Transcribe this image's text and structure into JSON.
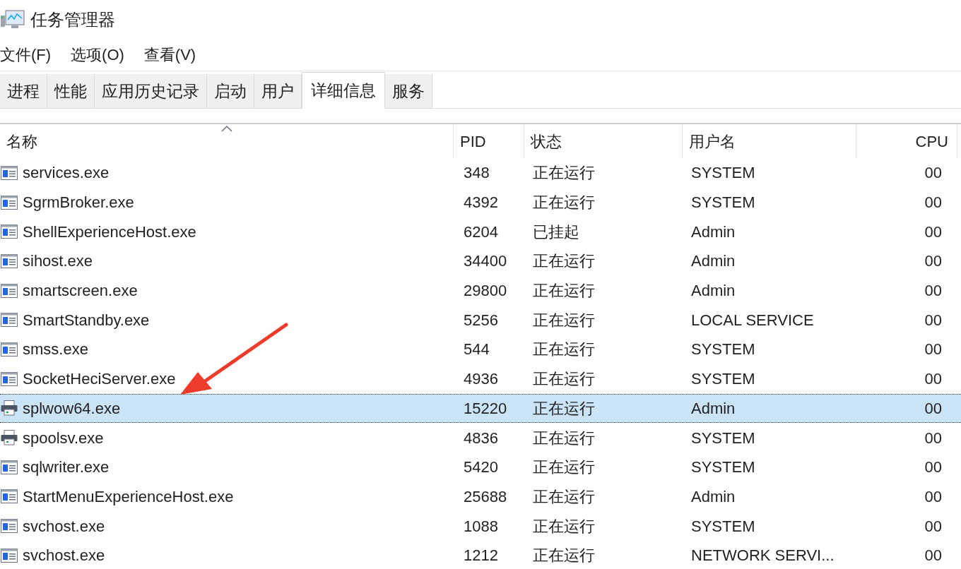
{
  "window": {
    "title": "任务管理器"
  },
  "menu": [
    "文件(F)",
    "选项(O)",
    "查看(V)"
  ],
  "tabs": [
    {
      "label": "进程",
      "selected": false
    },
    {
      "label": "性能",
      "selected": false
    },
    {
      "label": "应用历史记录",
      "selected": false
    },
    {
      "label": "启动",
      "selected": false
    },
    {
      "label": "用户",
      "selected": false
    },
    {
      "label": "详细信息",
      "selected": true
    },
    {
      "label": "服务",
      "selected": false
    }
  ],
  "table": {
    "columns": [
      {
        "label": "名称",
        "sorted": true
      },
      {
        "label": "PID",
        "sorted": false
      },
      {
        "label": "状态",
        "sorted": false
      },
      {
        "label": "用户名",
        "sorted": false
      },
      {
        "label": "CPU",
        "sorted": false
      }
    ],
    "rows": [
      {
        "kind": "app",
        "name": "services.exe",
        "pid": "348",
        "status": "正在运行",
        "user": "SYSTEM",
        "cpu": "00",
        "selected": false
      },
      {
        "kind": "app",
        "name": "SgrmBroker.exe",
        "pid": "4392",
        "status": "正在运行",
        "user": "SYSTEM",
        "cpu": "00",
        "selected": false
      },
      {
        "kind": "app",
        "name": "ShellExperienceHost.exe",
        "pid": "6204",
        "status": "已挂起",
        "user": "Admin",
        "cpu": "00",
        "selected": false
      },
      {
        "kind": "app",
        "name": "sihost.exe",
        "pid": "34400",
        "status": "正在运行",
        "user": "Admin",
        "cpu": "00",
        "selected": false
      },
      {
        "kind": "app",
        "name": "smartscreen.exe",
        "pid": "29800",
        "status": "正在运行",
        "user": "Admin",
        "cpu": "00",
        "selected": false
      },
      {
        "kind": "app",
        "name": "SmartStandby.exe",
        "pid": "5256",
        "status": "正在运行",
        "user": "LOCAL SERVICE",
        "cpu": "00",
        "selected": false
      },
      {
        "kind": "app",
        "name": "smss.exe",
        "pid": "544",
        "status": "正在运行",
        "user": "SYSTEM",
        "cpu": "00",
        "selected": false
      },
      {
        "kind": "app",
        "name": "SocketHeciServer.exe",
        "pid": "4936",
        "status": "正在运行",
        "user": "SYSTEM",
        "cpu": "00",
        "selected": false
      },
      {
        "kind": "printer",
        "name": "splwow64.exe",
        "pid": "15220",
        "status": "正在运行",
        "user": "Admin",
        "cpu": "00",
        "selected": true
      },
      {
        "kind": "printer",
        "name": "spoolsv.exe",
        "pid": "4836",
        "status": "正在运行",
        "user": "SYSTEM",
        "cpu": "00",
        "selected": false
      },
      {
        "kind": "app",
        "name": "sqlwriter.exe",
        "pid": "5420",
        "status": "正在运行",
        "user": "SYSTEM",
        "cpu": "00",
        "selected": false
      },
      {
        "kind": "app",
        "name": "StartMenuExperienceHost.exe",
        "pid": "25688",
        "status": "正在运行",
        "user": "Admin",
        "cpu": "00",
        "selected": false
      },
      {
        "kind": "app",
        "name": "svchost.exe",
        "pid": "1088",
        "status": "正在运行",
        "user": "SYSTEM",
        "cpu": "00",
        "selected": false
      },
      {
        "kind": "app",
        "name": "svchost.exe",
        "pid": "1212",
        "status": "正在运行",
        "user": "NETWORK SERVI...",
        "cpu": "00",
        "selected": false
      }
    ]
  }
}
